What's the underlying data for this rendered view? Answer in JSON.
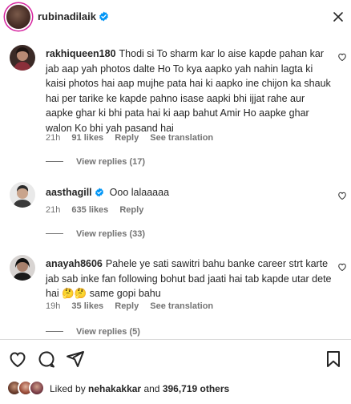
{
  "post": {
    "author": "rubinadilaik",
    "verified": true
  },
  "comments": [
    {
      "username": "rakhiqueen180",
      "text": "Thodi si To sharm kar lo aise kapde pahan kar jab aap yah photos dalte Ho To kya aapko yah nahin lagta ki kaisi photos hai aap mujhe pata hai ki aapko ine chijon ka shauk hai per tarike ke kapde pahno isase aapki bhi ijjat rahe aur aapke ghar ki bhi pata hai ki aap bahut Amir Ho aapke ghar walon Ko bhi yah pasand hai",
      "time": "21h",
      "likes": "91 likes",
      "reply": "Reply",
      "see_translation": "See translation",
      "view_replies": "View replies (17)"
    },
    {
      "username": "aasthagill",
      "verified": true,
      "text": "Ooo lalaaaaa",
      "time": "21h",
      "likes": "635 likes",
      "reply": "Reply",
      "view_replies": "View replies (33)"
    },
    {
      "username": "anayah8606",
      "text": "Pahele ye sati sawitri bahu banke career strt karte jab sab inke fan following bohut bad jaati hai tab kapde utar dete hai 🤔🤔 same gopi bahu",
      "time": "19h",
      "likes": "35 likes",
      "reply": "Reply",
      "see_translation": "See translation",
      "view_replies": "View replies (5)"
    }
  ],
  "liked_by": {
    "prefix": "Liked by",
    "user": "nehakakkar",
    "middle": "and",
    "count": "396,719 others"
  },
  "colors": {
    "text": "#262626",
    "muted": "#737373",
    "verified": "#0095f6",
    "divider": "#dbdbdb"
  },
  "icons": [
    "close-icon",
    "verified-icon",
    "heart-outline-icon",
    "comment-icon",
    "share-icon",
    "bookmark-icon"
  ]
}
